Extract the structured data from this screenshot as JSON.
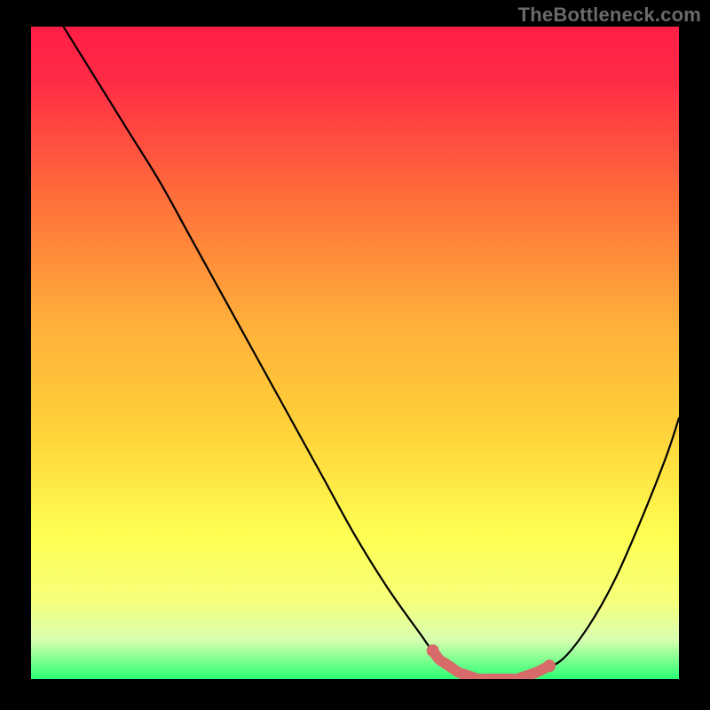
{
  "attribution": "TheBottleneck.com",
  "colors": {
    "gradient_top": "#ff1e46",
    "gradient_mid1": "#ff6a3a",
    "gradient_mid2": "#ffd23a",
    "gradient_mid3": "#fcff66",
    "gradient_mid4": "#e4ffa8",
    "gradient_bottom": "#2aff72",
    "curve": "#000000",
    "highlight": "#d96a6a",
    "frame": "#000000"
  },
  "chart_data": {
    "type": "line",
    "title": "",
    "xlabel": "",
    "ylabel": "",
    "xlim": [
      0,
      100
    ],
    "ylim": [
      0,
      100
    ],
    "x": [
      5,
      10,
      15,
      20,
      25,
      30,
      35,
      40,
      45,
      50,
      55,
      60,
      63,
      66,
      69,
      72,
      75,
      78,
      82,
      86,
      90,
      94,
      98,
      100
    ],
    "values": [
      100,
      92,
      84,
      76,
      67,
      58,
      49,
      40,
      31,
      22,
      14,
      7,
      3,
      1,
      0,
      0,
      0,
      1,
      3,
      8,
      15,
      24,
      34,
      40
    ],
    "highlight_range_x": [
      62,
      80
    ],
    "annotations": []
  }
}
